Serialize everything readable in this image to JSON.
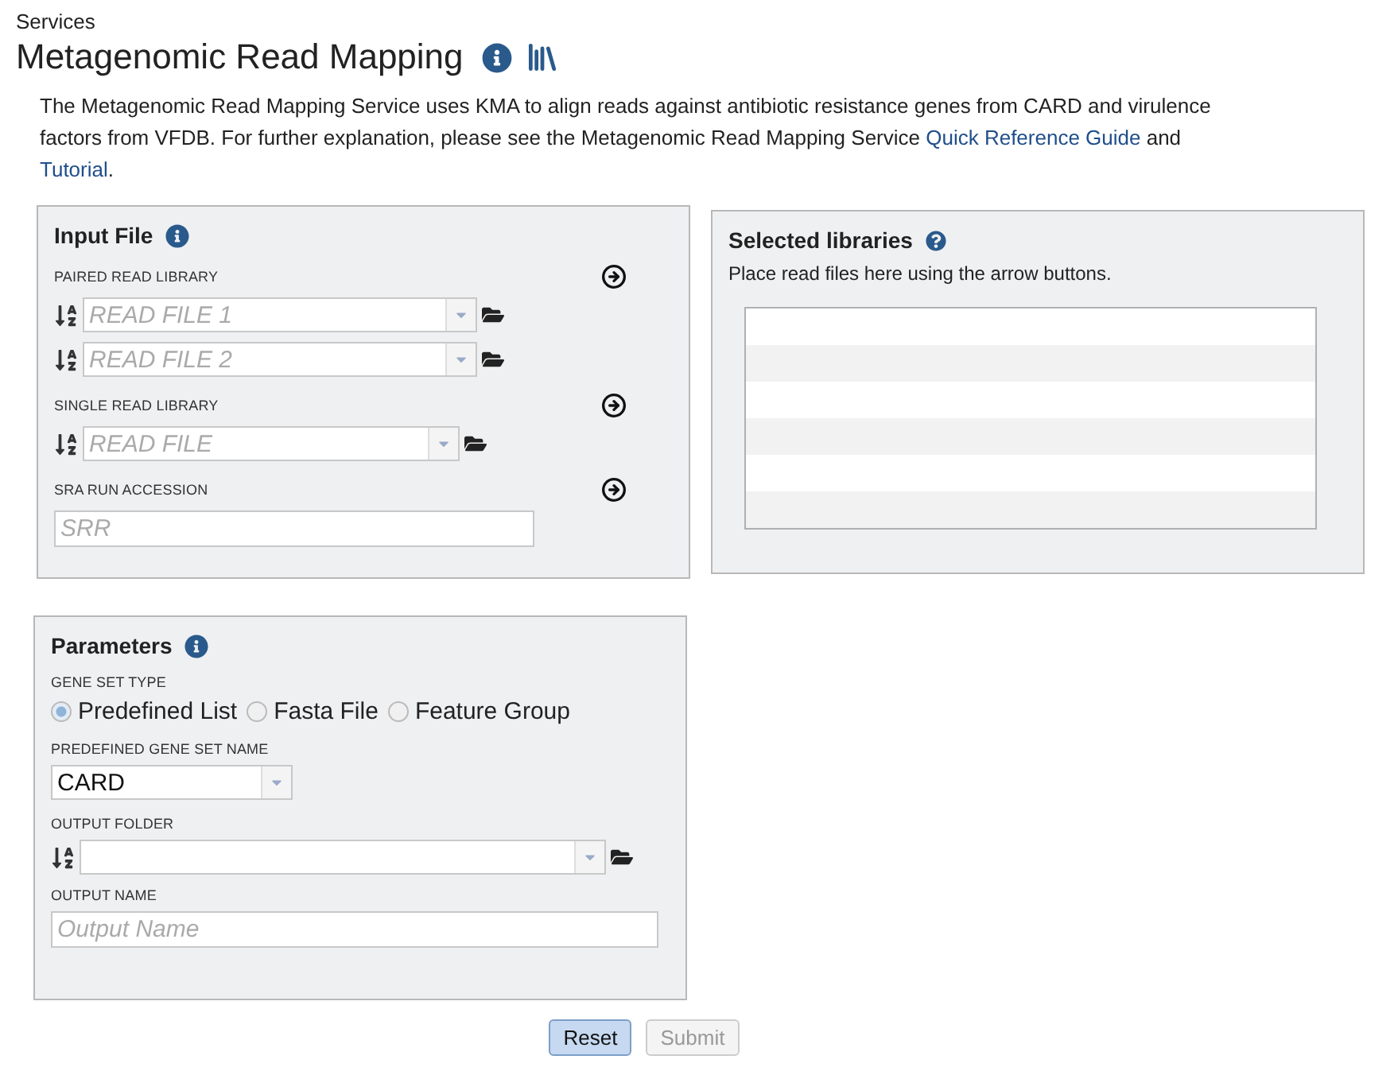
{
  "breadcrumb": "Services",
  "title": "Metagenomic Read Mapping",
  "description": [
    {
      "kind": "text",
      "text": "The Metagenomic Read Mapping Service uses KMA to align reads against antibiotic resistance genes from CARD and virulence factors from VFDB. For further explanation, please see the Metagenomic Read Mapping Service "
    },
    {
      "kind": "link",
      "text": "Quick Reference Guide"
    },
    {
      "kind": "text",
      "text": " and "
    },
    {
      "kind": "link",
      "text": "Tutorial"
    },
    {
      "kind": "text",
      "text": "."
    }
  ],
  "input_file": {
    "title": "Input File",
    "sections": [
      {
        "kind": "selects",
        "label": "PAIRED READ LIBRARY",
        "fields": [
          {
            "placeholder": "READ FILE 1"
          },
          {
            "placeholder": "READ FILE 2"
          }
        ]
      },
      {
        "kind": "selects",
        "label": "SINGLE READ LIBRARY",
        "fields": [
          {
            "placeholder": "READ FILE"
          }
        ]
      },
      {
        "kind": "text",
        "label": "SRA RUN ACCESSION",
        "placeholder": "SRR"
      }
    ]
  },
  "selected_libraries": {
    "title": "Selected libraries",
    "hint": "Place read files here using the arrow buttons."
  },
  "parameters": {
    "title": "Parameters",
    "gene_set_type": {
      "label": "GENE SET TYPE",
      "options": [
        {
          "label": "Predefined List",
          "selected": true
        },
        {
          "label": "Fasta File",
          "selected": false
        },
        {
          "label": "Feature Group",
          "selected": false
        }
      ]
    },
    "gene_set_name": {
      "label": "PREDEFINED GENE SET NAME",
      "value": "CARD"
    },
    "output_folder": {
      "label": "OUTPUT FOLDER"
    },
    "output_name": {
      "label": "OUTPUT NAME",
      "placeholder": "Output Name"
    }
  },
  "buttons": [
    {
      "label": "Reset",
      "disabled": false
    },
    {
      "label": "Submit",
      "disabled": true
    }
  ]
}
